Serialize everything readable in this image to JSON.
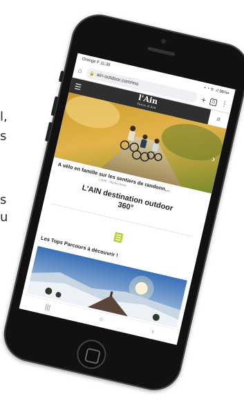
{
  "status": {
    "carrier_time": "Orange F  11:36",
    "icons": "▪ ◔ ᯤ .ıl 96%▪"
  },
  "browser": {
    "url": "ain-outdoor.com/mo",
    "tab_count": "⊡"
  },
  "site": {
    "logo": "l'Ain",
    "logo_sub": "Terre d'Ain"
  },
  "hero": {
    "caption": "A vélo en famille sur les sentiers de randonn…",
    "credit": "Crédit : Studio photo",
    "title_line1": "L'AIN destination outdoor",
    "title_line2": "360°"
  },
  "section": {
    "tops_title": "Les Tops Parcours à découvrir !"
  },
  "bg_text": {
    "a": "l,",
    "b": "s",
    "c": "s",
    "d": "u"
  },
  "colors": {
    "header": "#2f2f2f",
    "guide_icon": "#b5d334"
  }
}
